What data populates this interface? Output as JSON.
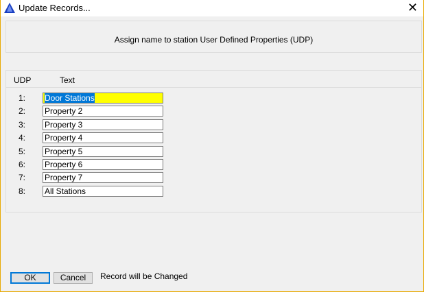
{
  "window": {
    "title": "Update Records..."
  },
  "header": {
    "text": "Assign name to station User Defined Properties (UDP)"
  },
  "table": {
    "col_udp": "UDP",
    "col_text": "Text",
    "rows": [
      {
        "n": "1:",
        "value": "Door Stations"
      },
      {
        "n": "2:",
        "value": "Property 2"
      },
      {
        "n": "3:",
        "value": "Property 3"
      },
      {
        "n": "4:",
        "value": "Property 4"
      },
      {
        "n": "5:",
        "value": "Property 5"
      },
      {
        "n": "6:",
        "value": "Property 6"
      },
      {
        "n": "7:",
        "value": "Property 7"
      },
      {
        "n": "8:",
        "value": "All Stations"
      }
    ]
  },
  "buttons": {
    "ok": "OK",
    "cancel": "Cancel"
  },
  "status": "Record will be Changed"
}
